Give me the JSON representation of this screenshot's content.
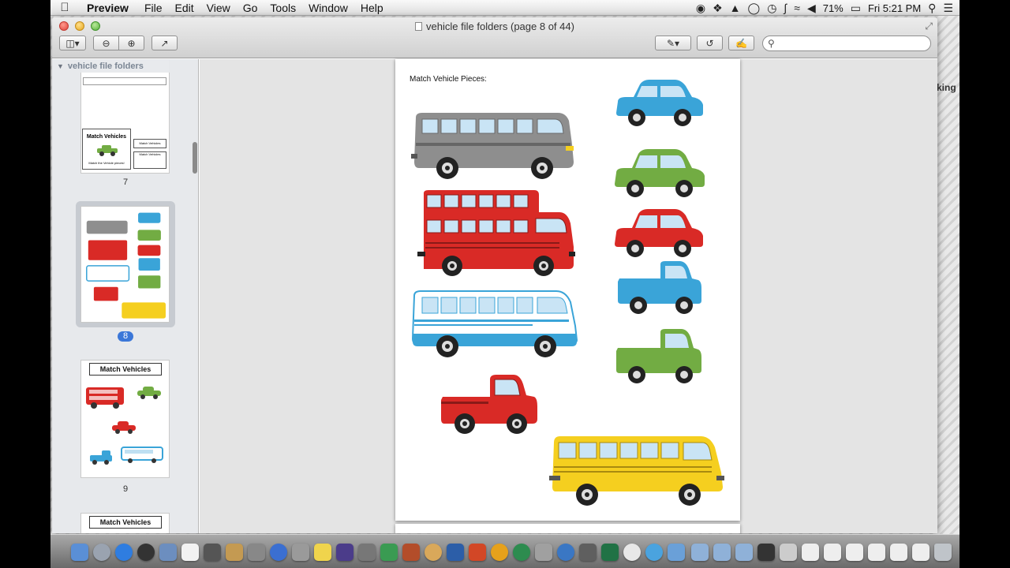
{
  "menubar": {
    "app_name": "Preview",
    "items": [
      "File",
      "Edit",
      "View",
      "Go",
      "Tools",
      "Window",
      "Help"
    ],
    "battery": "71%",
    "clock": "Fri 5:21 PM"
  },
  "window": {
    "title": "vehicle file folders (page 8 of 44)"
  },
  "sidebar": {
    "header": "vehicle file folders",
    "thumbnails": [
      {
        "label": "7",
        "mini_heading": "Match Vehicles",
        "mini_sub": "Match the Vehicle pieces!",
        "mini_small1": "Match Vehicles",
        "mini_small2": "Match Vehicles"
      },
      {
        "label": "8",
        "selected": true
      },
      {
        "label": "9",
        "mini_heading": "Match Vehicles"
      },
      {
        "mini_heading": "Match Vehicles"
      }
    ]
  },
  "document": {
    "heading": "Match Vehicle Pieces:"
  },
  "desktop": {
    "edge_text": "king"
  },
  "colors": {
    "gray_bus": "#8e8e8e",
    "red": "#d92a26",
    "blue": "#3aa4d8",
    "green": "#72ac43",
    "yellow": "#f5cf1f",
    "selection": "#3b77d8"
  },
  "icons": {
    "search": "search-icon",
    "zoom_in": "zoom-in-icon",
    "zoom_out": "zoom-out-icon",
    "share": "share-icon",
    "rotate": "rotate-icon",
    "annotate": "pen-icon",
    "edit": "edit-icon"
  }
}
